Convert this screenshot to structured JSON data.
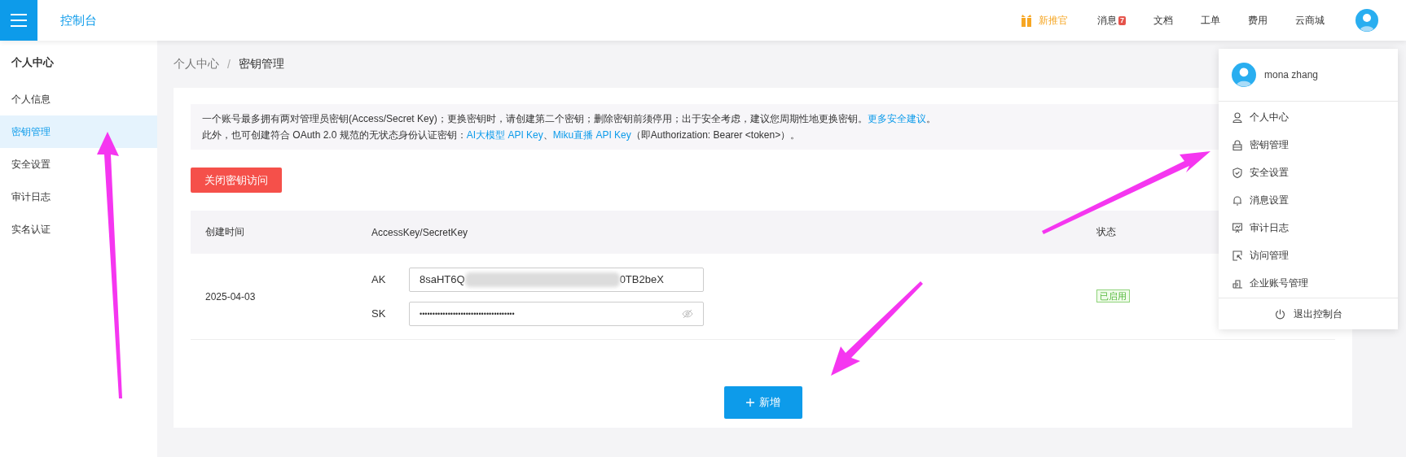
{
  "header": {
    "title": "控制台",
    "nav": [
      {
        "label": "新推官",
        "kind": "promo"
      },
      {
        "label": "消息",
        "kind": "badge",
        "badge": "7"
      },
      {
        "label": "文档",
        "kind": "link"
      },
      {
        "label": "工单",
        "kind": "link"
      },
      {
        "label": "费用",
        "kind": "link"
      },
      {
        "label": "云商城",
        "kind": "link"
      }
    ]
  },
  "sidebar": {
    "title": "个人中心",
    "items": [
      {
        "label": "个人信息",
        "selected": false
      },
      {
        "label": "密钥管理",
        "selected": true
      },
      {
        "label": "安全设置",
        "selected": false
      },
      {
        "label": "审计日志",
        "selected": false
      },
      {
        "label": "实名认证",
        "selected": false
      }
    ]
  },
  "breadcrumb": [
    "个人中心",
    "密钥管理"
  ],
  "breadcrumb_separator": "/",
  "notice": {
    "lines": [
      [
        {
          "text": "一个账号最多拥有两对管理员密钥(Access/Secret Key)；更换密钥时，请创建第二个密钥；删除密钥前须停用；出于安全考虑，建议您周期性地更换密钥。",
          "link": false
        },
        {
          "text": "更多安全建议",
          "link": true
        },
        {
          "text": "。",
          "link": false
        }
      ],
      [
        {
          "text": "此外，也可创建符合 OAuth 2.0 规范的无状态身份认证密钥：",
          "link": false
        },
        {
          "text": "AI大模型 API Key",
          "link": true
        },
        {
          "text": "、",
          "link": false
        },
        {
          "text": "Miku直播 API Key",
          "link": true
        },
        {
          "text": "（即Authorization: Bearer <token>）。",
          "link": false
        }
      ]
    ]
  },
  "close_button": "关闭密钥访问",
  "table": {
    "columns": [
      "创建时间",
      "AccessKey/SecretKey",
      "状态"
    ],
    "rows": [
      {
        "created": "2025-04-03",
        "ak_label": "AK",
        "ak_start": "8saHT6Q",
        "ak_end": "0TB2beX",
        "sk_label": "SK",
        "sk_value": "•••••••••••••••••••••••••••••••••••••",
        "status": "已启用"
      }
    ]
  },
  "add_button": "新增",
  "user_menu": {
    "name": "mona zhang",
    "items": [
      {
        "label": "个人中心",
        "kind": "user"
      },
      {
        "label": "密钥管理",
        "kind": "lock"
      },
      {
        "label": "安全设置",
        "kind": "shield"
      },
      {
        "label": "消息设置",
        "kind": "bell"
      },
      {
        "label": "审计日志",
        "kind": "monitor"
      },
      {
        "label": "访问管理",
        "kind": "cursor"
      },
      {
        "label": "企业账号管理",
        "kind": "building"
      }
    ],
    "logout": "退出控制台"
  }
}
